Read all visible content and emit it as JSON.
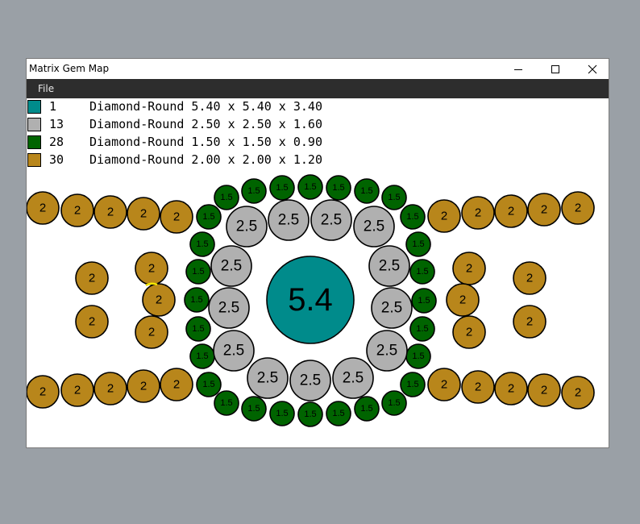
{
  "window": {
    "title": "Matrix Gem Map",
    "menu": {
      "file_label": "File"
    }
  },
  "colors": {
    "teal": "#008b8b",
    "gray": "#b0b0b0",
    "green": "#006400",
    "gold": "#b8861b",
    "yellow_mark": "#f2e600"
  },
  "legend": [
    {
      "color": "#008b8b",
      "count": "1",
      "desc": "Diamond-Round 5.40 x 5.40 x 3.40"
    },
    {
      "color": "#b0b0b0",
      "count": "13",
      "desc": "Diamond-Round 2.50 x 2.50 x 1.60"
    },
    {
      "color": "#006400",
      "count": "28",
      "desc": "Diamond-Round 1.50 x 1.50 x 0.90"
    },
    {
      "color": "#b8861b",
      "count": "30",
      "desc": "Diamond-Round 2.00 x 2.00 x 1.20"
    }
  ],
  "gem_labels": {
    "center": "5.4",
    "gray": "2.5",
    "green": "1.5",
    "gold": "2"
  }
}
